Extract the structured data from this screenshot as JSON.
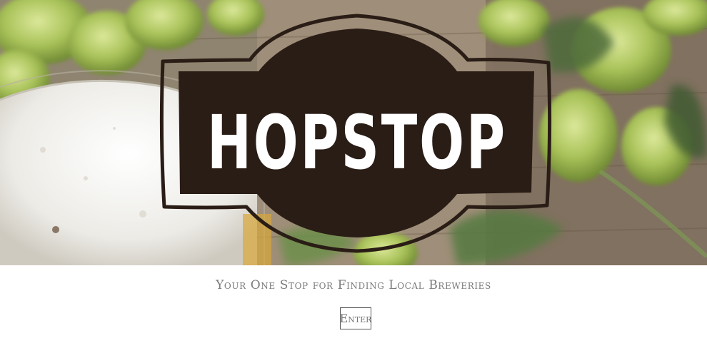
{
  "hero": {
    "logo_text": "HOPSTOP"
  },
  "tagline": "Your One Stop for Finding Local Breweries",
  "enter_button": {
    "label": "Enter"
  },
  "colors": {
    "logo_fill": "#2a1d16",
    "logo_text": "#ffffff",
    "tagline": "#7a7a7a",
    "hop_green": "#a8c45a"
  }
}
